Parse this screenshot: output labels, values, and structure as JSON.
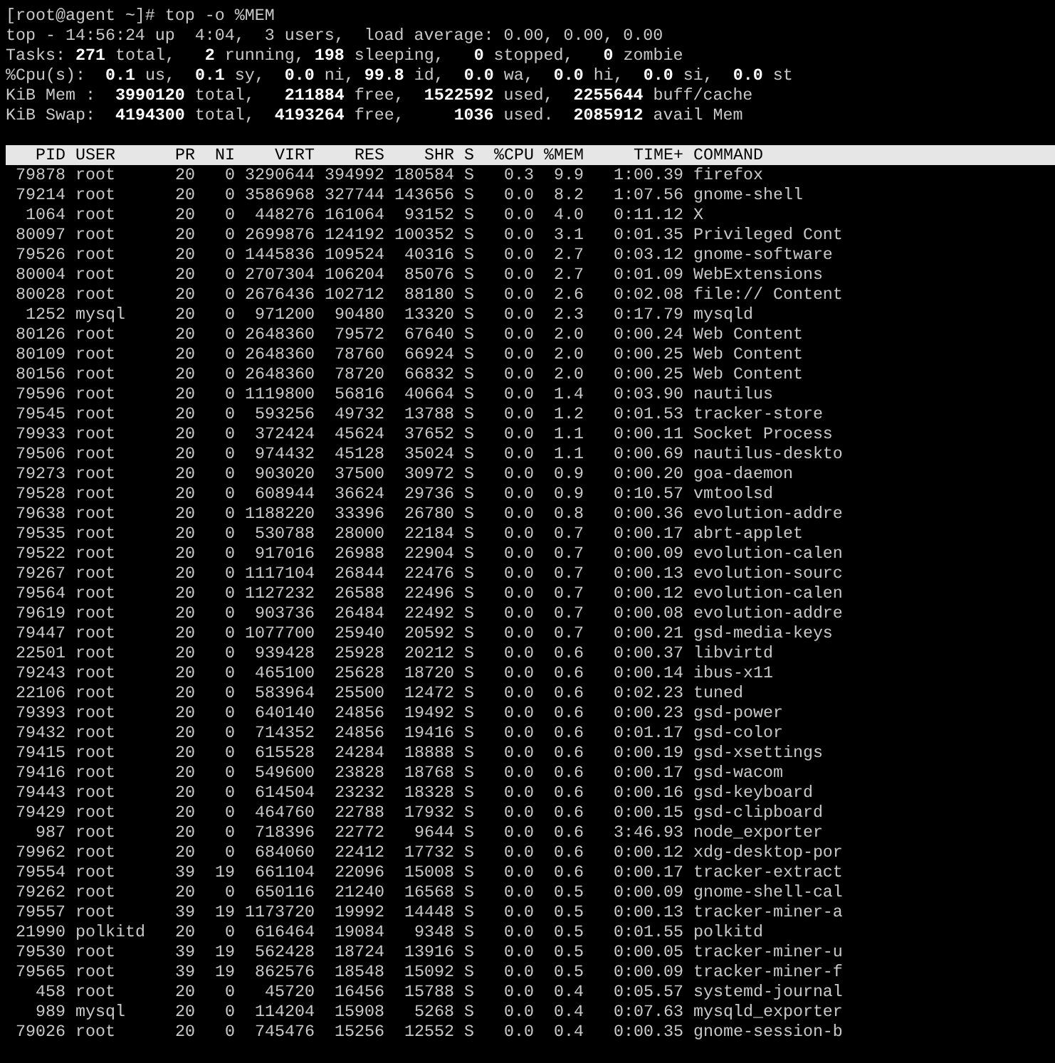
{
  "terminal": {
    "prompt_line": "[root@agent ~]# top -o %MEM",
    "summary_lines": [
      "top - 14:56:24 up  4:04,  3 users,  load average: 0.00, 0.00, 0.00",
      "Tasks: **271** total,   **2** running, **198** sleeping,   **0** stopped,   **0** zombie",
      "%Cpu(s):  **0.1** us,  **0.1** sy,  **0.0** ni, **99.8** id,  **0.0** wa,  **0.0** hi,  **0.0** si,  **0.0** st",
      "KiB Mem :  **3990120** total,   **211884** free,  **1522592** used,  **2255644** buff/cache",
      "KiB Swap:  **4194300** total,  **4193264** free,     **1036** used.  **2085912** avail Mem"
    ],
    "table": {
      "columns": [
        "PID",
        "USER",
        "PR",
        "NI",
        "VIRT",
        "RES",
        "SHR",
        "S",
        "%CPU",
        "%MEM",
        "TIME+",
        "COMMAND"
      ],
      "rows": [
        [
          "79878",
          "root",
          "20",
          "0",
          "3290644",
          "394992",
          "180584",
          "S",
          "0.3",
          "9.9",
          "1:00.39",
          "firefox"
        ],
        [
          "79214",
          "root",
          "20",
          "0",
          "3586968",
          "327744",
          "143656",
          "S",
          "0.0",
          "8.2",
          "1:07.56",
          "gnome-shell"
        ],
        [
          "1064",
          "root",
          "20",
          "0",
          "448276",
          "161064",
          "93152",
          "S",
          "0.0",
          "4.0",
          "0:11.12",
          "X"
        ],
        [
          "80097",
          "root",
          "20",
          "0",
          "2699876",
          "124192",
          "100352",
          "S",
          "0.0",
          "3.1",
          "0:01.35",
          "Privileged Cont"
        ],
        [
          "79526",
          "root",
          "20",
          "0",
          "1445836",
          "109524",
          "40316",
          "S",
          "0.0",
          "2.7",
          "0:03.12",
          "gnome-software"
        ],
        [
          "80004",
          "root",
          "20",
          "0",
          "2707304",
          "106204",
          "85076",
          "S",
          "0.0",
          "2.7",
          "0:01.09",
          "WebExtensions"
        ],
        [
          "80028",
          "root",
          "20",
          "0",
          "2676436",
          "102712",
          "88180",
          "S",
          "0.0",
          "2.6",
          "0:02.08",
          "file:// Content"
        ],
        [
          "1252",
          "mysql",
          "20",
          "0",
          "971200",
          "90480",
          "13320",
          "S",
          "0.0",
          "2.3",
          "0:17.79",
          "mysqld"
        ],
        [
          "80126",
          "root",
          "20",
          "0",
          "2648360",
          "79572",
          "67640",
          "S",
          "0.0",
          "2.0",
          "0:00.24",
          "Web Content"
        ],
        [
          "80109",
          "root",
          "20",
          "0",
          "2648360",
          "78760",
          "66924",
          "S",
          "0.0",
          "2.0",
          "0:00.25",
          "Web Content"
        ],
        [
          "80156",
          "root",
          "20",
          "0",
          "2648360",
          "78720",
          "66832",
          "S",
          "0.0",
          "2.0",
          "0:00.25",
          "Web Content"
        ],
        [
          "79596",
          "root",
          "20",
          "0",
          "1119800",
          "56816",
          "40664",
          "S",
          "0.0",
          "1.4",
          "0:03.90",
          "nautilus"
        ],
        [
          "79545",
          "root",
          "20",
          "0",
          "593256",
          "49732",
          "13788",
          "S",
          "0.0",
          "1.2",
          "0:01.53",
          "tracker-store"
        ],
        [
          "79933",
          "root",
          "20",
          "0",
          "372424",
          "45624",
          "37652",
          "S",
          "0.0",
          "1.1",
          "0:00.11",
          "Socket Process"
        ],
        [
          "79506",
          "root",
          "20",
          "0",
          "974432",
          "45128",
          "35024",
          "S",
          "0.0",
          "1.1",
          "0:00.69",
          "nautilus-deskto"
        ],
        [
          "79273",
          "root",
          "20",
          "0",
          "903020",
          "37500",
          "30972",
          "S",
          "0.0",
          "0.9",
          "0:00.20",
          "goa-daemon"
        ],
        [
          "79528",
          "root",
          "20",
          "0",
          "608944",
          "36624",
          "29736",
          "S",
          "0.0",
          "0.9",
          "0:10.57",
          "vmtoolsd"
        ],
        [
          "79638",
          "root",
          "20",
          "0",
          "1188220",
          "33396",
          "26780",
          "S",
          "0.0",
          "0.8",
          "0:00.36",
          "evolution-addre"
        ],
        [
          "79535",
          "root",
          "20",
          "0",
          "530788",
          "28000",
          "22184",
          "S",
          "0.0",
          "0.7",
          "0:00.17",
          "abrt-applet"
        ],
        [
          "79522",
          "root",
          "20",
          "0",
          "917016",
          "26988",
          "22904",
          "S",
          "0.0",
          "0.7",
          "0:00.09",
          "evolution-calen"
        ],
        [
          "79267",
          "root",
          "20",
          "0",
          "1117104",
          "26844",
          "22476",
          "S",
          "0.0",
          "0.7",
          "0:00.13",
          "evolution-sourc"
        ],
        [
          "79564",
          "root",
          "20",
          "0",
          "1127232",
          "26588",
          "22496",
          "S",
          "0.0",
          "0.7",
          "0:00.12",
          "evolution-calen"
        ],
        [
          "79619",
          "root",
          "20",
          "0",
          "903736",
          "26484",
          "22492",
          "S",
          "0.0",
          "0.7",
          "0:00.08",
          "evolution-addre"
        ],
        [
          "79447",
          "root",
          "20",
          "0",
          "1077700",
          "25940",
          "20592",
          "S",
          "0.0",
          "0.7",
          "0:00.21",
          "gsd-media-keys"
        ],
        [
          "22501",
          "root",
          "20",
          "0",
          "939428",
          "25928",
          "20212",
          "S",
          "0.0",
          "0.6",
          "0:00.37",
          "libvirtd"
        ],
        [
          "79243",
          "root",
          "20",
          "0",
          "465100",
          "25628",
          "18720",
          "S",
          "0.0",
          "0.6",
          "0:00.14",
          "ibus-x11"
        ],
        [
          "22106",
          "root",
          "20",
          "0",
          "583964",
          "25500",
          "12472",
          "S",
          "0.0",
          "0.6",
          "0:02.23",
          "tuned"
        ],
        [
          "79393",
          "root",
          "20",
          "0",
          "640140",
          "24856",
          "19492",
          "S",
          "0.0",
          "0.6",
          "0:00.23",
          "gsd-power"
        ],
        [
          "79432",
          "root",
          "20",
          "0",
          "714352",
          "24856",
          "19416",
          "S",
          "0.0",
          "0.6",
          "0:01.17",
          "gsd-color"
        ],
        [
          "79415",
          "root",
          "20",
          "0",
          "615528",
          "24284",
          "18888",
          "S",
          "0.0",
          "0.6",
          "0:00.19",
          "gsd-xsettings"
        ],
        [
          "79416",
          "root",
          "20",
          "0",
          "549600",
          "23828",
          "18768",
          "S",
          "0.0",
          "0.6",
          "0:00.17",
          "gsd-wacom"
        ],
        [
          "79443",
          "root",
          "20",
          "0",
          "614504",
          "23232",
          "18328",
          "S",
          "0.0",
          "0.6",
          "0:00.16",
          "gsd-keyboard"
        ],
        [
          "79429",
          "root",
          "20",
          "0",
          "464760",
          "22788",
          "17932",
          "S",
          "0.0",
          "0.6",
          "0:00.15",
          "gsd-clipboard"
        ],
        [
          "987",
          "root",
          "20",
          "0",
          "718396",
          "22772",
          "9644",
          "S",
          "0.0",
          "0.6",
          "3:46.93",
          "node_exporter"
        ],
        [
          "79962",
          "root",
          "20",
          "0",
          "684060",
          "22412",
          "17732",
          "S",
          "0.0",
          "0.6",
          "0:00.12",
          "xdg-desktop-por"
        ],
        [
          "79554",
          "root",
          "39",
          "19",
          "661104",
          "22096",
          "15008",
          "S",
          "0.0",
          "0.6",
          "0:00.17",
          "tracker-extract"
        ],
        [
          "79262",
          "root",
          "20",
          "0",
          "650116",
          "21240",
          "16568",
          "S",
          "0.0",
          "0.5",
          "0:00.09",
          "gnome-shell-cal"
        ],
        [
          "79557",
          "root",
          "39",
          "19",
          "1173720",
          "19992",
          "14448",
          "S",
          "0.0",
          "0.5",
          "0:00.13",
          "tracker-miner-a"
        ],
        [
          "21990",
          "polkitd",
          "20",
          "0",
          "616464",
          "19084",
          "9348",
          "S",
          "0.0",
          "0.5",
          "0:01.55",
          "polkitd"
        ],
        [
          "79530",
          "root",
          "39",
          "19",
          "562428",
          "18724",
          "13916",
          "S",
          "0.0",
          "0.5",
          "0:00.05",
          "tracker-miner-u"
        ],
        [
          "79565",
          "root",
          "39",
          "19",
          "862576",
          "18548",
          "15092",
          "S",
          "0.0",
          "0.5",
          "0:00.09",
          "tracker-miner-f"
        ],
        [
          "458",
          "root",
          "20",
          "0",
          "45720",
          "16456",
          "15788",
          "S",
          "0.0",
          "0.4",
          "0:05.57",
          "systemd-journal"
        ],
        [
          "989",
          "mysql",
          "20",
          "0",
          "114204",
          "15908",
          "5268",
          "S",
          "0.0",
          "0.4",
          "0:07.63",
          "mysqld_exporter"
        ],
        [
          "79026",
          "root",
          "20",
          "0",
          "745476",
          "15256",
          "12552",
          "S",
          "0.0",
          "0.4",
          "0:00.35",
          "gnome-session-b"
        ]
      ]
    }
  }
}
